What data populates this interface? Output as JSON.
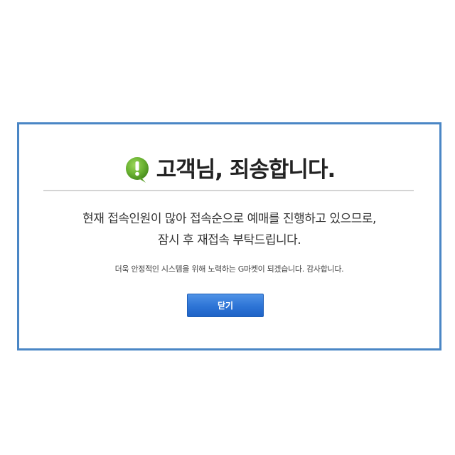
{
  "dialog": {
    "title": "고객님, 죄송합니다.",
    "icon": "exclamation-speech-bubble-icon",
    "icon_color": "#6bb332",
    "message_lines": [
      "현재 접속인원이 많아 접속순으로 예매를 진행하고 있으므로,",
      "잠시 후 재접속 부탁드립니다."
    ],
    "note": "더욱 안정적인 시스템을 위해 노력하는 G마켓이 되겠습니다. 감사합니다.",
    "close_label": "닫기",
    "border_color": "#4a86c5",
    "button_color": "#2d74d6"
  }
}
